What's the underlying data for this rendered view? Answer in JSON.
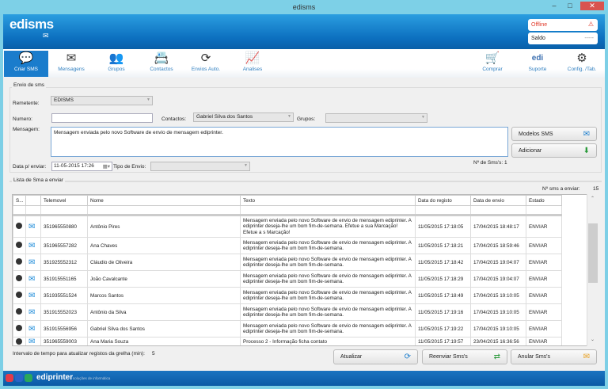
{
  "window": {
    "title": "edisms",
    "minimize": "–",
    "maximize": "□",
    "close": "✕"
  },
  "header": {
    "logo": "edisms",
    "status": "Offline",
    "status_color": "#e03a2a",
    "balance_label": "Saldo",
    "balance_value": "-----"
  },
  "toolbar": {
    "items": [
      {
        "label": "Criar SMS",
        "icon": "chat-icon",
        "glyph": "💬"
      },
      {
        "label": "Mensagens",
        "icon": "envelope-icon",
        "glyph": "✉"
      },
      {
        "label": "Grupos",
        "icon": "group-icon",
        "glyph": "👥"
      },
      {
        "label": "Contactos",
        "icon": "contacts-book-icon",
        "glyph": "📇"
      },
      {
        "label": "Envios Auto.",
        "icon": "clock-refresh-icon",
        "glyph": "⟳"
      },
      {
        "label": "Analises",
        "icon": "chart-monitor-icon",
        "glyph": "📈"
      }
    ],
    "right": [
      {
        "label": "Comprar",
        "icon": "cart-icon",
        "glyph": "🛒"
      },
      {
        "label": "Suporte",
        "icon": "support-icon",
        "glyph": "edi"
      },
      {
        "label": "Config. /Tab.",
        "icon": "gear-icon",
        "glyph": "⚙"
      }
    ]
  },
  "form": {
    "group_title": "Envio de sms",
    "remetente_label": "Remetente:",
    "remetente_value": "EDISMS",
    "numero_label": "Numero:",
    "numero_value": "",
    "contactos_label": "Contactos:",
    "contactos_value": "Gabriel Silva dos Santos",
    "grupos_label": "Grupos:",
    "grupos_value": "",
    "mensagem_label": "Mensagem:",
    "mensagem_value": "Mensagem enviada pelo novo Software de envio de mensagem ediprinter.",
    "modelos_button": "Modelos SMS",
    "adicionar_button": "Adicionar",
    "num_sms_label": "Nº de Sms's:",
    "num_sms_value": "1",
    "data_label": "Data p/ enviar:",
    "data_value": "11-05-2015 17:26",
    "tipo_label": "Tipo de Envio:",
    "tipo_value": ""
  },
  "list": {
    "title": "Lista de Sma a enviar",
    "count_label": "Nº sms a enviar:",
    "count_value": "15",
    "columns": [
      "S...",
      "",
      "Telemovel",
      "Nome",
      "Texto",
      "Data do registo",
      "Data de envio",
      "Estado"
    ],
    "rows": [
      {
        "phone": "351965550880",
        "name": "Antônio Pires",
        "text": "Mensagem enviada pelo novo Software de envio de mensagem ediprinter. A ediprinter deseja-lhe um bom fim-de-semana. Efetue a sua Marcação! Efetue a s Marcação!",
        "reg": "11/05/2015 17:18:05",
        "sent": "17/04/2015 18:48:17",
        "state": "ENVIAR"
      },
      {
        "phone": "351965557282",
        "name": "Ana Chaves",
        "text": "Mensagem enviada pelo novo Software de envio de mensagem ediprinter. A ediprinter deseja-lhe um bom fim-de-semana.",
        "reg": "11/05/2015 17:18:21",
        "sent": "17/04/2015 18:59:46",
        "state": "ENVIAR"
      },
      {
        "phone": "351925552312",
        "name": "Cláudio de Oliveira",
        "text": "Mensagem enviada pelo novo Software de envio de mensagem ediprinter. A ediprinter deseja-lhe um bom fim-de-semana.",
        "reg": "11/05/2015 17:18:42",
        "sent": "17/04/2015 19:04:07",
        "state": "ENVIAR"
      },
      {
        "phone": "351915551165",
        "name": "João Cavalcante",
        "text": "Mensagem enviada pelo novo Software de envio de mensagem ediprinter. A ediprinter deseja-lhe um bom fim-de-semana.",
        "reg": "11/05/2015 17:18:29",
        "sent": "17/04/2015 19:04:07",
        "state": "ENVIAR"
      },
      {
        "phone": "351935551524",
        "name": "Marcos Santos",
        "text": "Mensagem enviada pelo novo Software de envio de mensagem ediprinter. A ediprinter deseja-lhe um bom fim-de-semana.",
        "reg": "11/05/2015 17:18:49",
        "sent": "17/04/2015 19:10:05",
        "state": "ENVIAR"
      },
      {
        "phone": "351915552023",
        "name": "Antônio da Silva",
        "text": "Mensagem enviada pelo novo Software de envio de mensagem ediprinter. A ediprinter deseja-lhe um bom fim-de-semana.",
        "reg": "11/05/2015 17:19:16",
        "sent": "17/04/2015 19:10:05",
        "state": "ENVIAR"
      },
      {
        "phone": "351915556956",
        "name": "Gabriel Silva dos Santos",
        "text": "Mensagem enviada pelo novo Software de envio de mensagem ediprinter. A ediprinter deseja-lhe um bom fim-de-semana.",
        "reg": "11/05/2015 17:19:22",
        "sent": "17/04/2015 19:10:05",
        "state": "ENVIAR"
      },
      {
        "phone": "351965559003",
        "name": "Ana Maria Souza",
        "text": "Processo 2 - Informação ficha contato",
        "reg": "11/05/2015 17:19:57",
        "sent": "23/04/2015 16:36:56",
        "state": "ENVIAR"
      }
    ]
  },
  "bottom": {
    "interval_label": "Intervalo de tempo para atualizar registos da grelha (min):",
    "interval_value": "5",
    "atualizar": "Atualizar",
    "reenviar": "Reenviar Sms's",
    "anular": "Anular Sms's"
  },
  "footer": {
    "brand": "ediprinter",
    "tagline": "soluções de informática"
  }
}
